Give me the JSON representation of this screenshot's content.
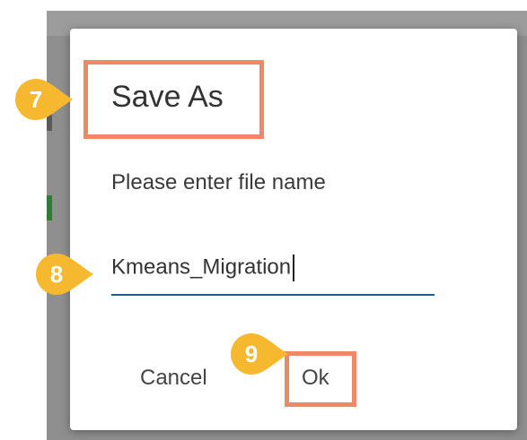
{
  "dialog": {
    "title": "Save As",
    "prompt": "Please enter file name",
    "filename_value": "Kmeans_Migration",
    "cancel_label": "Cancel",
    "ok_label": "Ok"
  },
  "callouts": [
    {
      "number": "7"
    },
    {
      "number": "8"
    },
    {
      "number": "9"
    }
  ],
  "colors": {
    "callout": "#f5b82e",
    "highlight": "#ee8866",
    "input_underline": "#1f5f87",
    "overlay": "#8f8f8f"
  }
}
